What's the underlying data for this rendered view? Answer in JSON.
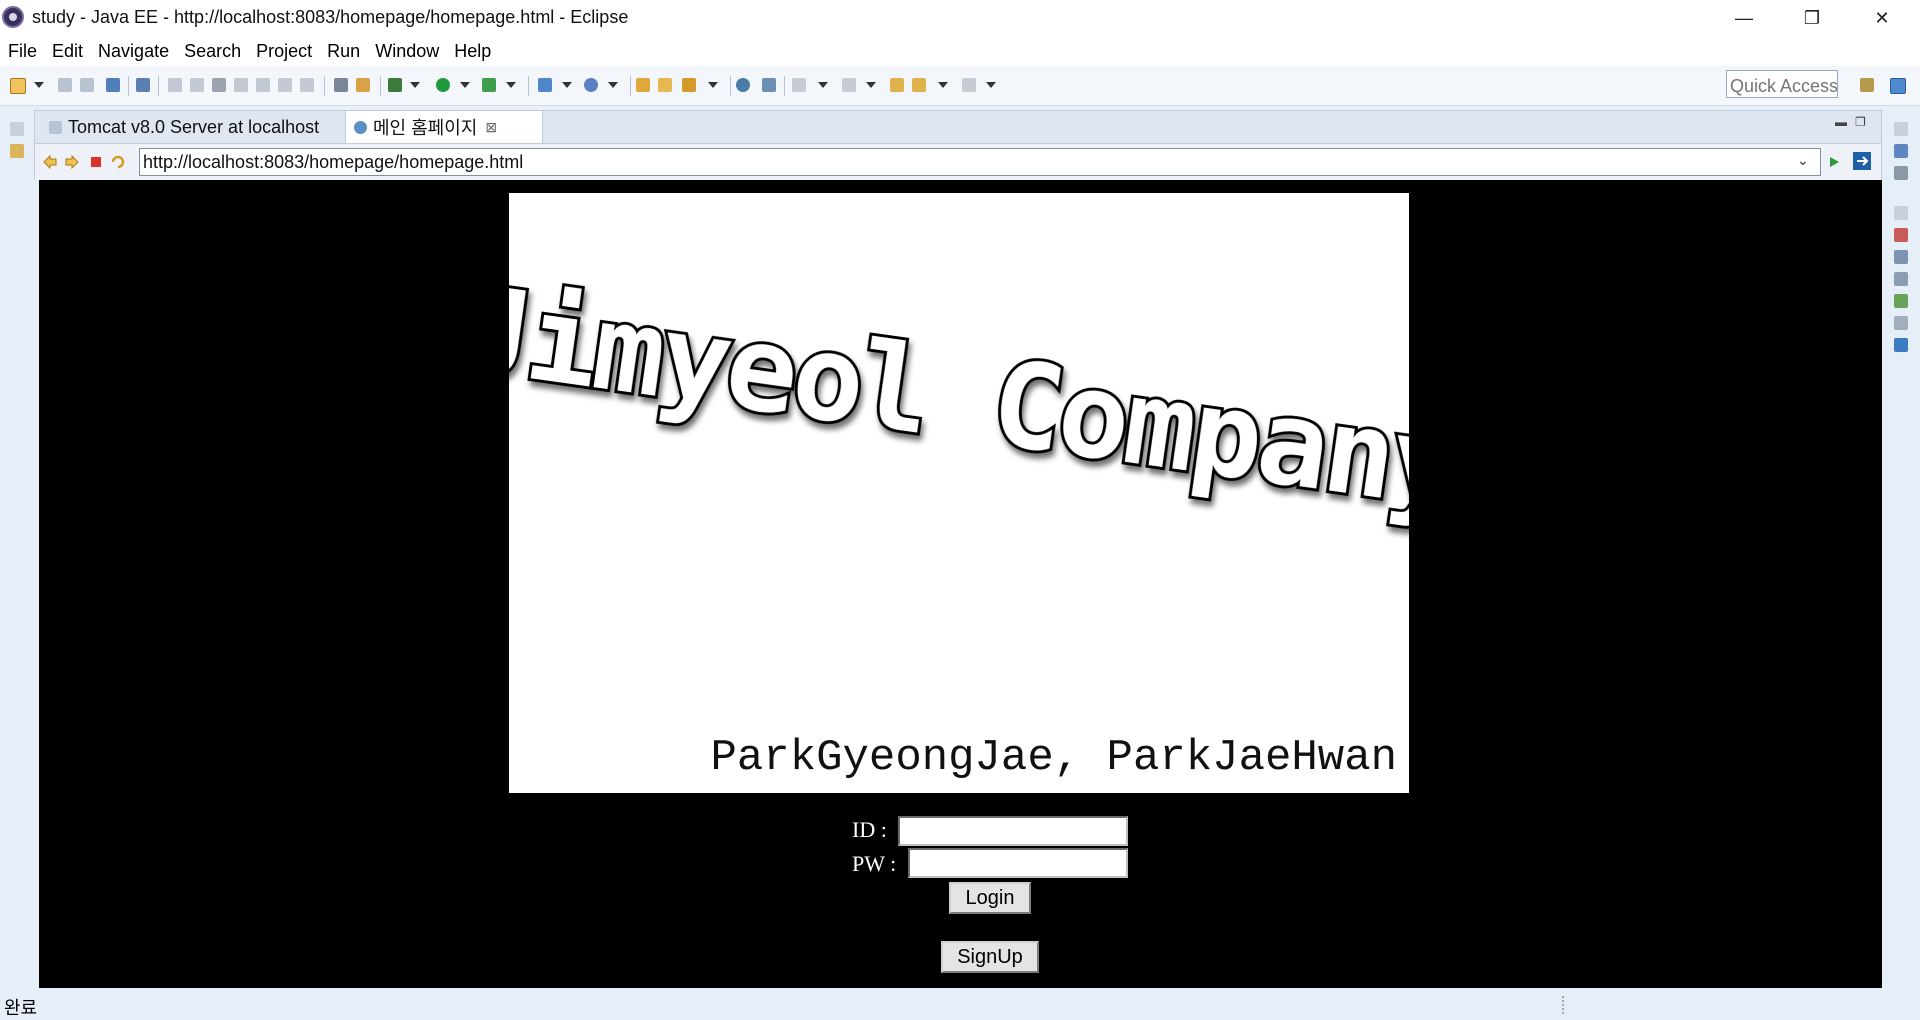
{
  "window": {
    "title": "study - Java EE - http://localhost:8083/homepage/homepage.html - Eclipse",
    "minimize": "—",
    "restore": "❐",
    "close": "✕"
  },
  "menu": {
    "items": [
      "File",
      "Edit",
      "Navigate",
      "Search",
      "Project",
      "Run",
      "Window",
      "Help"
    ]
  },
  "toolbar": {
    "quick_access_placeholder": "Quick Access"
  },
  "tabs": {
    "server_tab": "Tomcat v8.0 Server at localhost",
    "browser_tab": "메인 홈페이지",
    "close_glyph": "⊠"
  },
  "browser": {
    "url": "http://localhost:8083/homepage/homepage.html",
    "dropdown_glyph": "⌄"
  },
  "page": {
    "logo_text": "Jimyeol Company",
    "authors": "ParkGyeongJae, ParkJaeHwan",
    "id_label": "ID :",
    "pw_label": "PW :",
    "id_value": "",
    "pw_value": "",
    "login_button": "Login",
    "signup_button": "SignUp"
  },
  "status": {
    "text": "완료"
  },
  "colors": {
    "webview_background": "#000000",
    "banner_background": "#ffffff",
    "chrome_background": "#e6eef7"
  }
}
